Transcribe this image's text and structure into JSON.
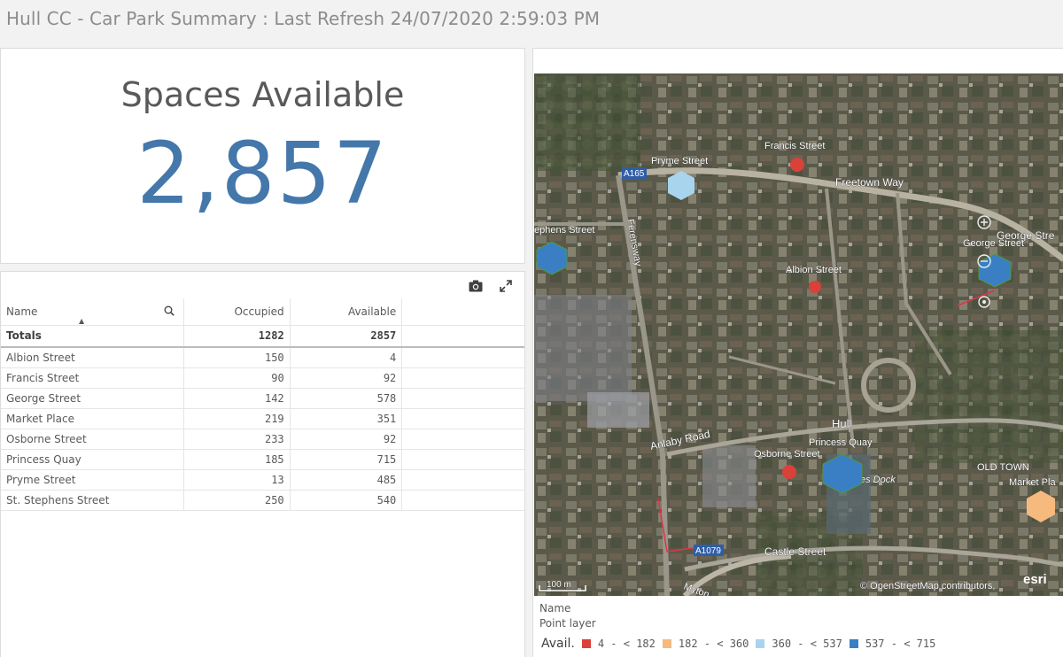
{
  "header": {
    "title": "Hull CC - Car Park Summary : Last Refresh 24/07/2020 2:59:03 PM"
  },
  "kpi": {
    "label": "Spaces Available",
    "value": "2,857"
  },
  "table": {
    "columns": [
      "Name",
      "Occupied",
      "Available"
    ],
    "totals": {
      "label": "Totals",
      "occupied": "1282",
      "available": "2857"
    },
    "rows": [
      {
        "name": "Albion Street",
        "occupied": "150",
        "available": "4"
      },
      {
        "name": "Francis Street",
        "occupied": "90",
        "available": "92"
      },
      {
        "name": "George Street",
        "occupied": "142",
        "available": "578"
      },
      {
        "name": "Market Place",
        "occupied": "219",
        "available": "351"
      },
      {
        "name": "Osborne Street",
        "occupied": "233",
        "available": "92"
      },
      {
        "name": "Princess Quay",
        "occupied": "185",
        "available": "715"
      },
      {
        "name": "Pryme Street",
        "occupied": "13",
        "available": "485"
      },
      {
        "name": "St. Stephens Street",
        "occupied": "250",
        "available": "540"
      }
    ]
  },
  "map": {
    "labels": {
      "francis": "Francis Street",
      "pryme": "Pryme Street",
      "freetown": "Freetown Way",
      "a165": "A165",
      "stephens": "ephens Street",
      "ferensway": "Ferensway",
      "george1": "George Stre",
      "george2": "George Street",
      "albion": "Albion Street",
      "hull": "Hull",
      "princess": "Princess Quay",
      "osborne": "Osborne Street",
      "anlaby": "Anlaby Road",
      "dock": "es Dock",
      "oldtown": "OLD TOWN",
      "market": "Market Pla",
      "a1079": "A1079",
      "castle": "Castle Street",
      "myton": "Myton",
      "scale": "100 m",
      "attribution": "© OpenStreetMap contributors,",
      "esri": "esri"
    },
    "legend_title": "Name",
    "legend_sub": "Point layer",
    "avail_label": "Avail.",
    "ranges": [
      {
        "label": "4 - < 182",
        "color": "#d9413a"
      },
      {
        "label": "182 - < 360",
        "color": "#f6b97e"
      },
      {
        "label": "360 - < 537",
        "color": "#a8d4ee"
      },
      {
        "label": "537 - < 715",
        "color": "#3a7fc4"
      }
    ]
  }
}
